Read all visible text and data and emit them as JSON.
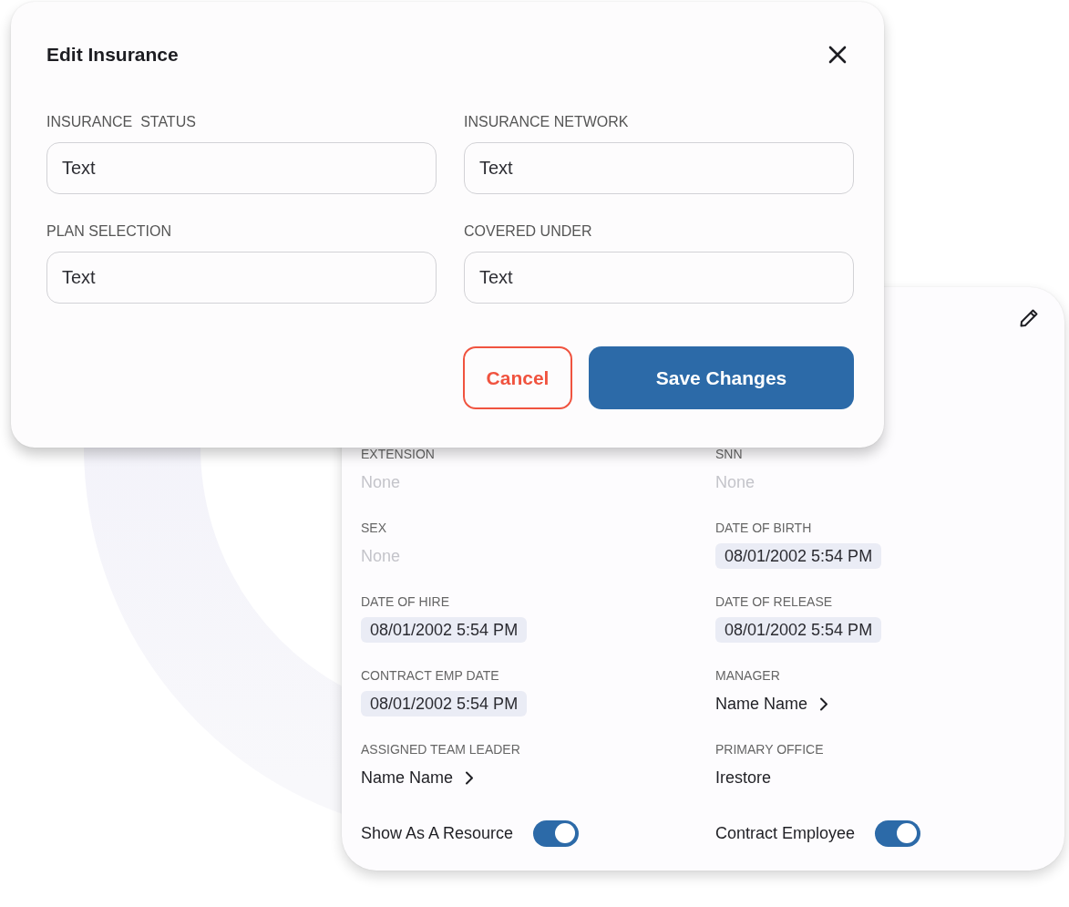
{
  "modal": {
    "title": "Edit Insurance",
    "fields": [
      {
        "label": "INSURANCE  STATUS",
        "value": "Text"
      },
      {
        "label": "INSURANCE NETWORK",
        "value": "Text"
      },
      {
        "label": "PLAN SELECTION",
        "value": "Text"
      },
      {
        "label": "COVERED UNDER",
        "value": "Text"
      }
    ],
    "buttons": [
      {
        "label": "Cancel",
        "kind": "secondary"
      },
      {
        "label": "Save Changes",
        "kind": "primary"
      }
    ]
  },
  "profile_card": {
    "fields": [
      {
        "label": "EXTENSION",
        "value": "None",
        "kind": "empty"
      },
      {
        "label": "SNN",
        "value": "None",
        "kind": "empty"
      },
      {
        "label": "SEX",
        "value": "None",
        "kind": "empty"
      },
      {
        "label": "DATE OF BIRTH",
        "value": "08/01/2002 5:54 PM",
        "kind": "date"
      },
      {
        "label": "DATE OF HIRE",
        "value": "08/01/2002 5:54 PM",
        "kind": "date"
      },
      {
        "label": "DATE OF RELEASE",
        "value": "08/01/2002 5:54 PM",
        "kind": "date"
      },
      {
        "label": "CONTRACT EMP DATE",
        "value": "08/01/2002 5:54 PM",
        "kind": "date"
      },
      {
        "label": "MANAGER",
        "value": "Name Name",
        "kind": "link"
      },
      {
        "label": "ASSIGNED TEAM LEADER",
        "value": "Name Name",
        "kind": "link"
      },
      {
        "label": "PRIMARY OFFICE",
        "value": "Irestore",
        "kind": "text"
      }
    ],
    "toggles": [
      {
        "label": "Show As A Resource",
        "on": true
      },
      {
        "label": "Contract Employee",
        "on": true
      }
    ]
  }
}
